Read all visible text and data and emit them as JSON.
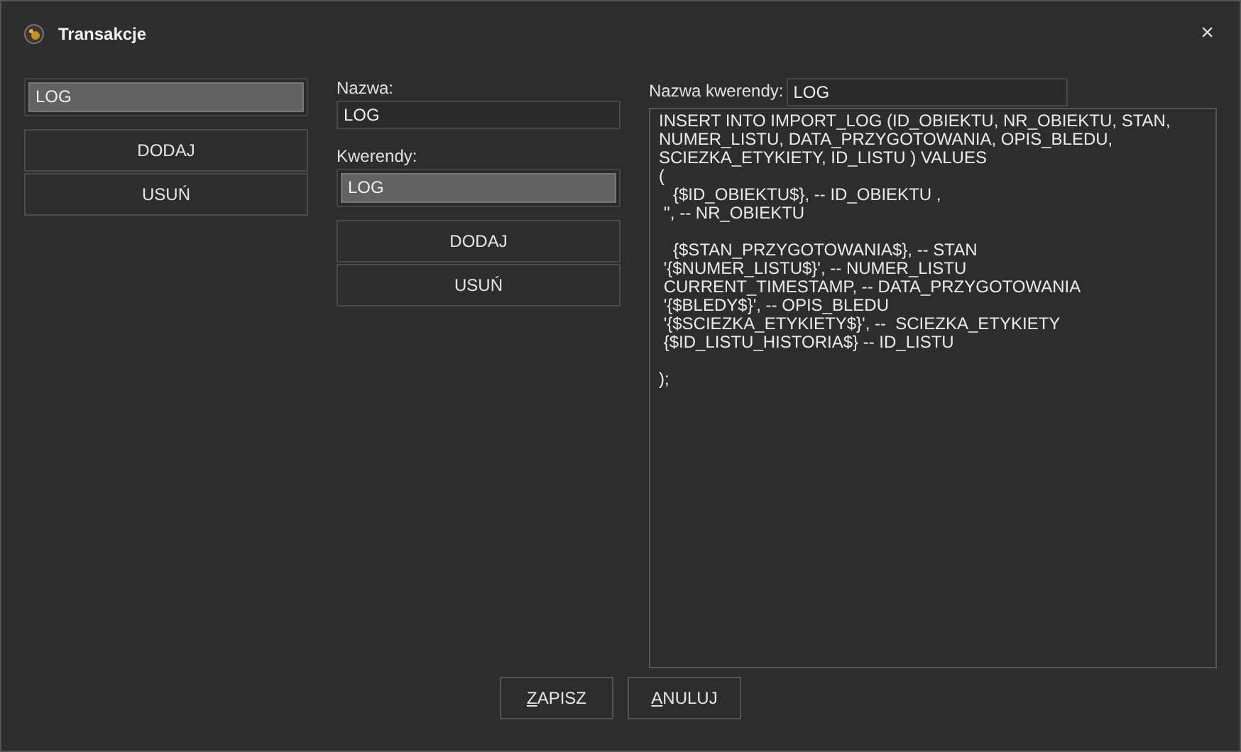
{
  "window": {
    "title": "Transakcje",
    "close": "×"
  },
  "transactions": {
    "items": [
      {
        "label": "LOG",
        "selected": true
      }
    ],
    "buttons": [
      "DODAJ",
      "USUŃ"
    ]
  },
  "name_field": {
    "label": "Nazwa:",
    "value": "LOG"
  },
  "queries": {
    "label": "Kwerendy:",
    "items": [
      {
        "label": "LOG",
        "selected": true
      }
    ],
    "buttons": [
      "DODAJ",
      "USUŃ"
    ]
  },
  "query_name": {
    "label": "Nazwa kwerendy:",
    "value": "LOG"
  },
  "query_text": "INSERT INTO IMPORT_LOG (ID_OBIEKTU, NR_OBIEKTU, STAN,\nNUMER_LISTU, DATA_PRZYGOTOWANIA, OPIS_BLEDU,\nSCIEZKA_ETYKIETY, ID_LISTU ) VALUES\n(\n   {$ID_OBIEKTU$}, -- ID_OBIEKTU ,\n '', -- NR_OBIEKTU\n\n   {$STAN_PRZYGOTOWANIA$}, -- STAN\n '{$NUMER_LISTU$}', -- NUMER_LISTU\n CURRENT_TIMESTAMP, -- DATA_PRZYGOTOWANIA\n '{$BLEDY$}', -- OPIS_BLEDU\n '{$SCIEZKA_ETYKIETY$}', --  SCIEZKA_ETYKIETY\n {$ID_LISTU_HISTORIA$} -- ID_LISTU\n\n);",
  "footer_buttons": [
    {
      "label": "ZAPISZ",
      "mnemonic_underlined": true
    },
    {
      "label": "ANULUJ",
      "mnemonic_underlined": true
    }
  ]
}
